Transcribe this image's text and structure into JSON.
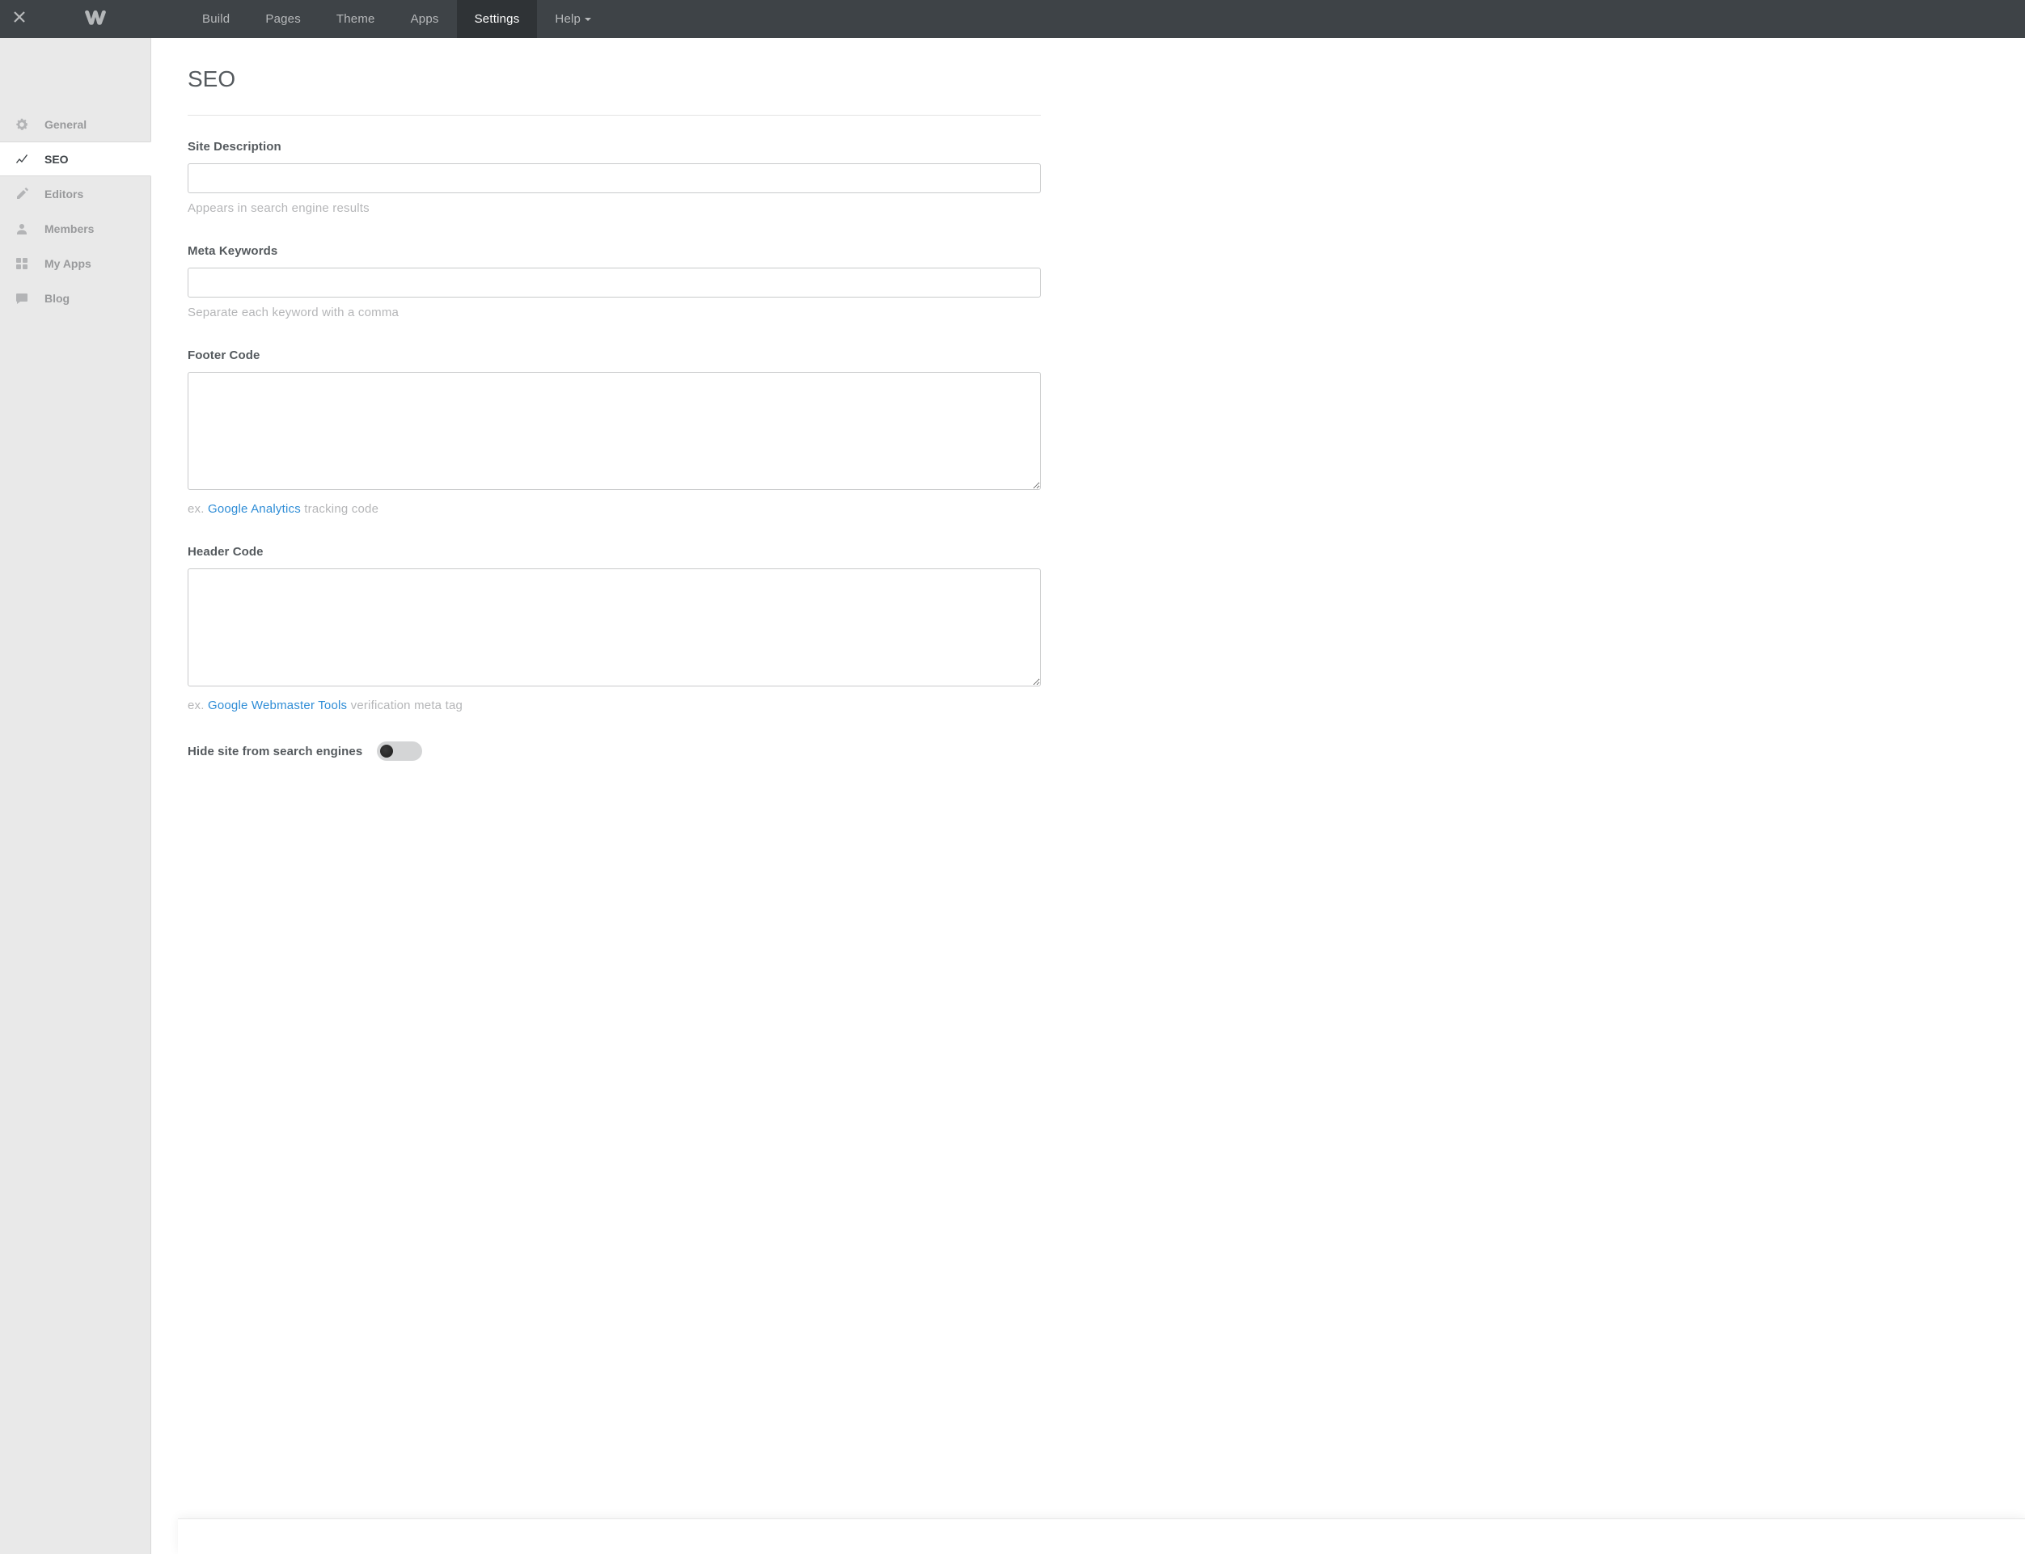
{
  "topnav": {
    "items": [
      {
        "label": "Build",
        "active": false
      },
      {
        "label": "Pages",
        "active": false
      },
      {
        "label": "Theme",
        "active": false
      },
      {
        "label": "Apps",
        "active": false
      },
      {
        "label": "Settings",
        "active": true
      },
      {
        "label": "Help",
        "active": false,
        "has_caret": true
      }
    ]
  },
  "sidebar": {
    "items": [
      {
        "label": "General",
        "icon": "gear",
        "active": false
      },
      {
        "label": "SEO",
        "icon": "trending",
        "active": true
      },
      {
        "label": "Editors",
        "icon": "pencil",
        "active": false
      },
      {
        "label": "Members",
        "icon": "user",
        "active": false
      },
      {
        "label": "My Apps",
        "icon": "grid",
        "active": false
      },
      {
        "label": "Blog",
        "icon": "comment",
        "active": false
      }
    ]
  },
  "page": {
    "title": "SEO"
  },
  "fields": {
    "site_description": {
      "label": "Site Description",
      "value": "",
      "hint": "Appears in search engine results"
    },
    "meta_keywords": {
      "label": "Meta Keywords",
      "value": "",
      "hint": "Separate each keyword with a comma"
    },
    "footer_code": {
      "label": "Footer Code",
      "value": "",
      "hint_prefix": "ex. ",
      "hint_link": "Google Analytics",
      "hint_suffix": " tracking code"
    },
    "header_code": {
      "label": "Header Code",
      "value": "",
      "hint_prefix": "ex. ",
      "hint_link": "Google Webmaster Tools",
      "hint_suffix": " verification meta tag"
    },
    "hide_site": {
      "label": "Hide site from search engines",
      "value": false
    }
  }
}
